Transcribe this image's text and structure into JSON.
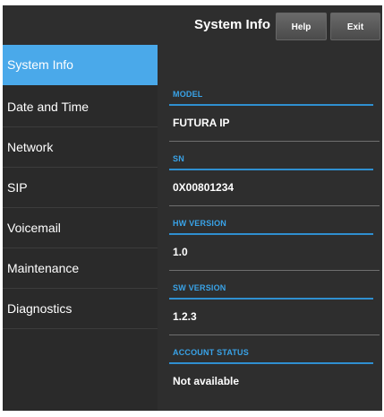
{
  "header": {
    "title": "System Info",
    "help_label": "Help",
    "exit_label": "Exit"
  },
  "sidebar": {
    "items": [
      {
        "label": "System Info",
        "active": true
      },
      {
        "label": "Date and Time",
        "active": false
      },
      {
        "label": "Network",
        "active": false
      },
      {
        "label": "SIP",
        "active": false
      },
      {
        "label": "Voicemail",
        "active": false
      },
      {
        "label": "Maintenance",
        "active": false
      },
      {
        "label": "Diagnostics",
        "active": false
      }
    ]
  },
  "fields": [
    {
      "label": "MODEL",
      "value": "FUTURA IP"
    },
    {
      "label": "SN",
      "value": "0X00801234"
    },
    {
      "label": "HW VERSION",
      "value": "1.0"
    },
    {
      "label": "SW VERSION",
      "value": "1.2.3"
    },
    {
      "label": "ACCOUNT STATUS",
      "value": "Not available"
    }
  ],
  "colors": {
    "accent": "#4aa9ea",
    "label": "#39a3e8",
    "background": "#2e2e2e"
  }
}
